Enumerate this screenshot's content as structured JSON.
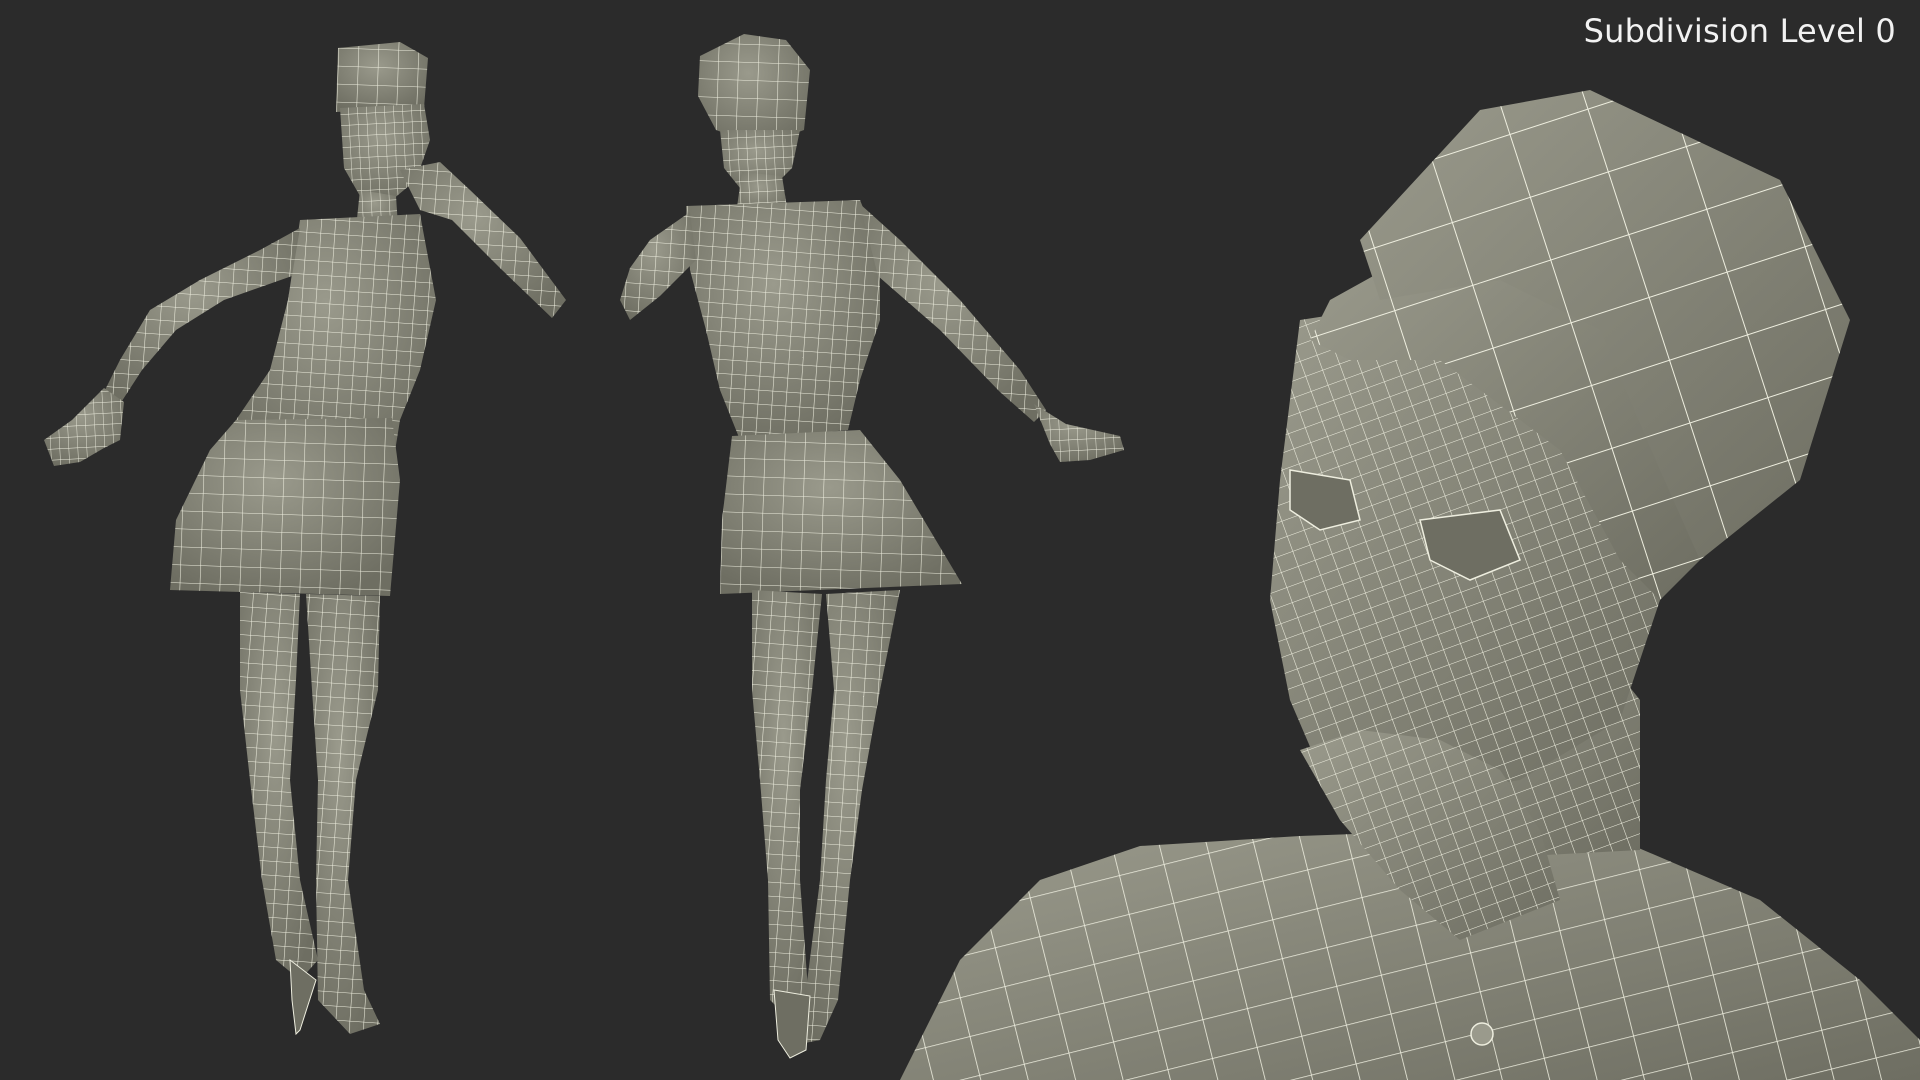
{
  "label": {
    "text": "Subdivision Level 0"
  },
  "colors": {
    "background": "#2b2b2b",
    "surface": "#858577",
    "surface_dark": "#6e6e62",
    "surface_light": "#9a9a8c",
    "wire": "#eeeedf",
    "label_text": "#f2f2f2"
  },
  "views": [
    {
      "name": "front-view",
      "subject": "wireframe-figure"
    },
    {
      "name": "back-view",
      "subject": "wireframe-figure"
    },
    {
      "name": "closeup-view",
      "subject": "wireframe-head-closeup"
    }
  ]
}
